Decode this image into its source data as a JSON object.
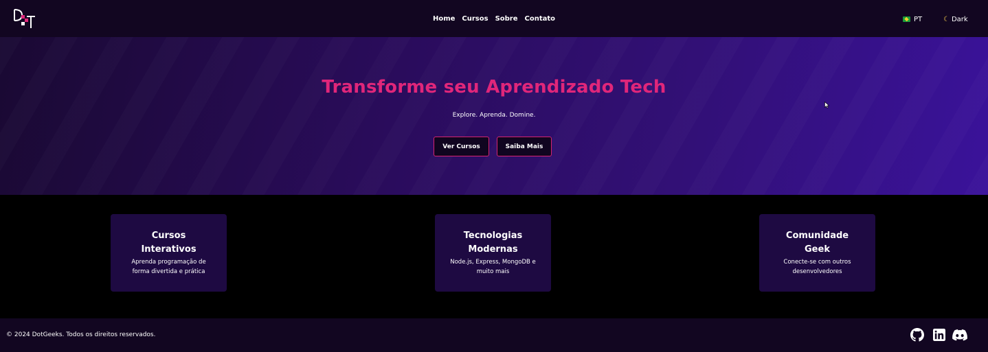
{
  "header": {
    "logo_icon": "dotgeeks-logo-icon",
    "nav": [
      {
        "label": "Home"
      },
      {
        "label": "Cursos"
      },
      {
        "label": "Sobre"
      },
      {
        "label": "Contato"
      }
    ],
    "language": {
      "flag_icon": "brazil-flag-icon",
      "label": "PT"
    },
    "theme": {
      "icon": "moon-icon",
      "label": "Dark"
    }
  },
  "hero": {
    "title": "Transforme seu Aprendizado Tech",
    "subtitle": "Explore. Aprenda. Domine.",
    "buttons": [
      {
        "label": "Ver Cursos"
      },
      {
        "label": "Saiba Mais"
      }
    ]
  },
  "features": [
    {
      "title": "Cursos Interativos",
      "description": "Aprenda programação de forma divertida e prática"
    },
    {
      "title": "Tecnologias Modernas",
      "description": "Node.js, Express, MongoDB e muito mais"
    },
    {
      "title": "Comunidade Geek",
      "description": "Conecte-se com outros desenvolvedores"
    }
  ],
  "footer": {
    "copyright": "© 2024 DotGeeks. Todos os direitos reservados.",
    "social": [
      {
        "icon": "github-icon"
      },
      {
        "icon": "linkedin-icon"
      },
      {
        "icon": "discord-icon"
      }
    ]
  },
  "colors": {
    "accent": "#e0267a",
    "header_bg": "#120621",
    "card_bg": "#1e0a42",
    "hero_gradient_end": "#3a129a"
  }
}
